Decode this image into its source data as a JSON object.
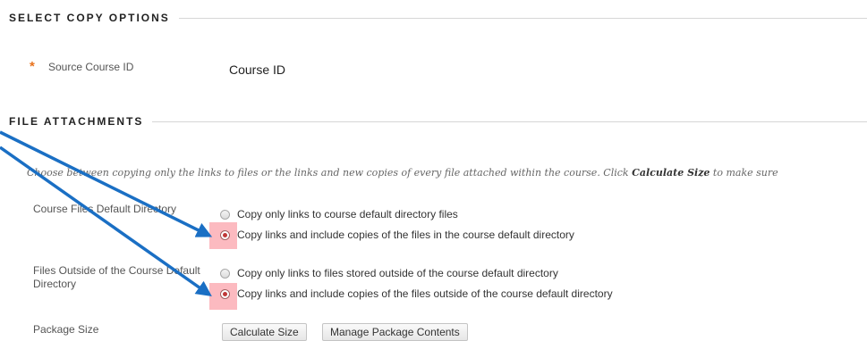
{
  "sections": {
    "select_copy": "SELECT COPY OPTIONS",
    "file_attachments": "FILE ATTACHMENTS"
  },
  "source_course": {
    "required_mark": "*",
    "label": "Source Course ID",
    "value": "Course ID"
  },
  "instructions": {
    "before": "Choose between copying only the links to files or the links and new copies of every file attached within the course. Click ",
    "bold": "Calculate Size",
    "after": " to make sure"
  },
  "default_dir": {
    "label": "Course Files Default Directory",
    "options": [
      {
        "label": "Copy only links to course default directory files",
        "checked": false
      },
      {
        "label": "Copy links and include copies of the files in the course default directory",
        "checked": true
      }
    ]
  },
  "outside_dir": {
    "label": "Files Outside of the Course Default Directory",
    "options": [
      {
        "label": "Copy only links to files stored outside of the course default directory",
        "checked": false
      },
      {
        "label": "Copy links and include copies of the files outside of the course default directory",
        "checked": true
      }
    ]
  },
  "package_size": {
    "label": "Package Size",
    "calculate_button": "Calculate Size",
    "manage_button": "Manage Package Contents"
  },
  "colors": {
    "annotation_arrow": "#1a6fc4",
    "highlight": "#f8828c",
    "required": "#e8721c"
  }
}
